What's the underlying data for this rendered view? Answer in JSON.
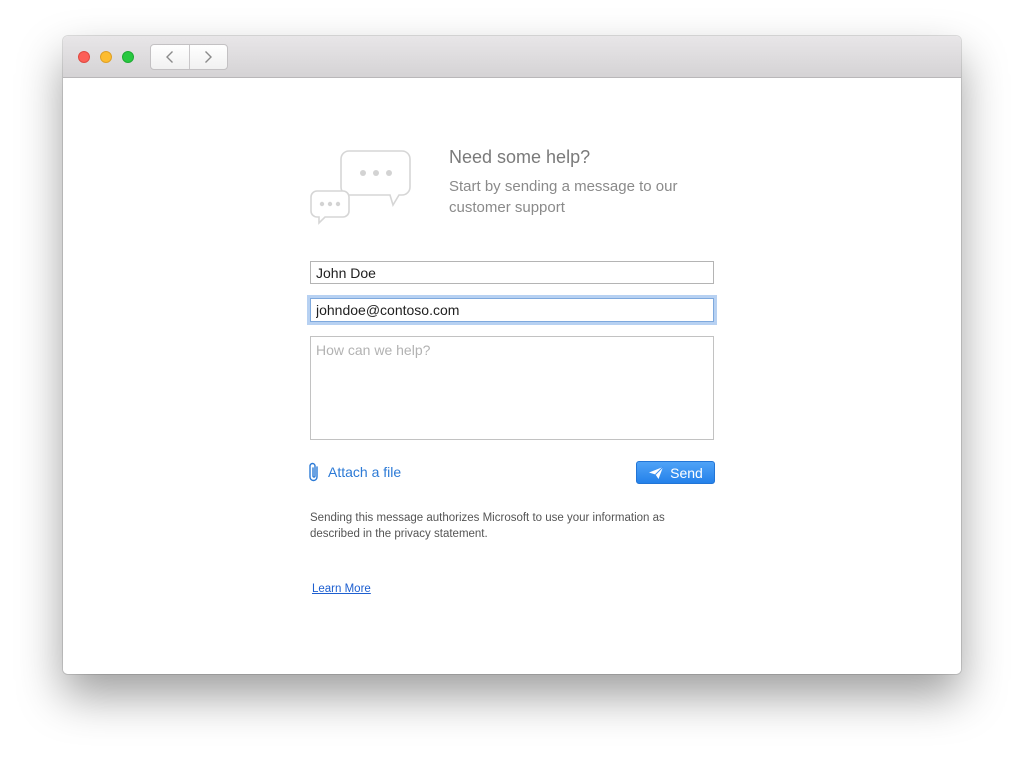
{
  "window": {
    "controls": [
      "close",
      "minimize",
      "zoom"
    ],
    "nav": {
      "back_icon": "chevron-left-icon",
      "forward_icon": "chevron-right-icon"
    }
  },
  "header": {
    "icon": "chat-bubbles-icon",
    "title": "Need some help?",
    "subtitle": "Start by sending a message to our customer support"
  },
  "form": {
    "name_value": "John Doe",
    "email_value": "johndoe@contoso.com",
    "message_value": "",
    "message_placeholder": "How can we help?",
    "attach_label": "Attach a file",
    "attach_icon": "paperclip-icon",
    "send_label": "Send",
    "send_icon": "paper-plane-icon"
  },
  "footer": {
    "disclaimer": "Sending this message authorizes Microsoft to use your information as described in the privacy statement.",
    "learn_more": "Learn More"
  },
  "colors": {
    "accent": "#2c7ad6",
    "send_button": "#3a93f1",
    "link": "#1d5fd0",
    "focus_ring": "#7babe8"
  }
}
